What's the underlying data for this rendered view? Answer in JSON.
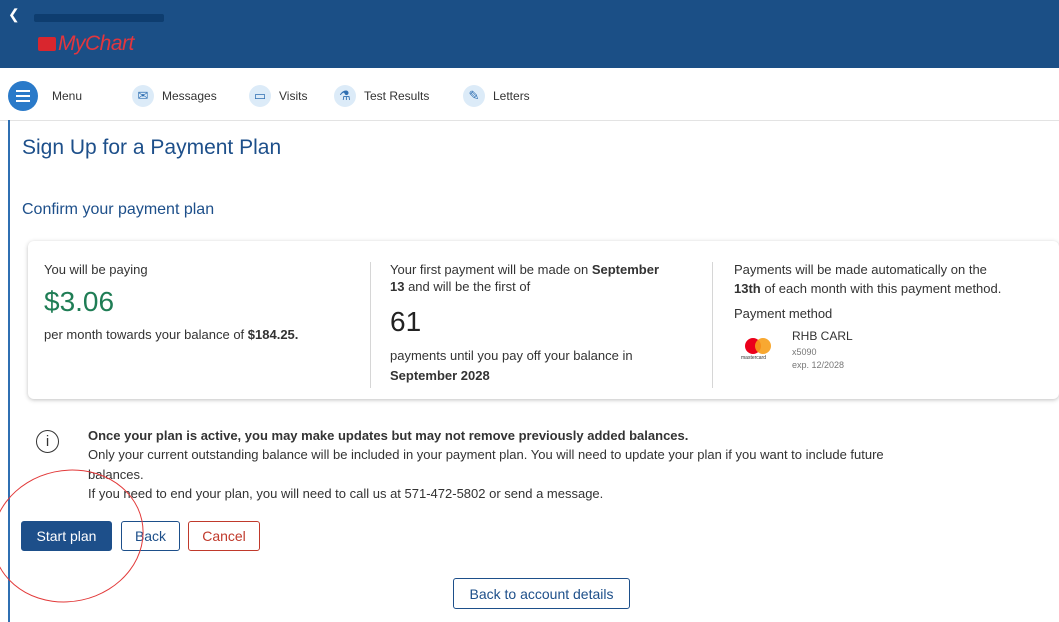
{
  "header": {
    "app_name": "MyChart"
  },
  "nav": {
    "menu_label": "Menu",
    "items": [
      {
        "label": "Messages",
        "icon": "envelope-icon"
      },
      {
        "label": "Visits",
        "icon": "calendar-icon"
      },
      {
        "label": "Test Results",
        "icon": "flask-icon"
      },
      {
        "label": "Letters",
        "icon": "letter-icon"
      }
    ]
  },
  "page": {
    "title": "Sign Up for a Payment Plan",
    "subtitle": "Confirm your payment plan"
  },
  "summary": {
    "col1": {
      "heading": "You will be paying",
      "amount": "$3.06",
      "text_before": "per month towards your balance of ",
      "balance": "$184.25."
    },
    "col2": {
      "line1_before": "Your first payment will be made on ",
      "line1_bold": "September",
      "line2_bold": "13",
      "line2_after": " and will be the first of",
      "count": "61",
      "line3": "payments until you pay off your balance in",
      "end_date": "September 2028"
    },
    "col3": {
      "line1": "Payments will be made automatically on the",
      "line2_bold": "13th",
      "line2_after": " of each month with this payment method.",
      "method_label": "Payment method",
      "card_name": "RHB CARL",
      "card_last4": "x5090",
      "card_exp": "exp. 12/2028",
      "card_brand": "mastercard"
    }
  },
  "notice": {
    "heading": "Once your plan is active, you may make updates but may not remove previously added balances.",
    "line1": "Only your current outstanding balance will be included in your payment plan. You will need to update your plan if you want to include future",
    "line2": "balances.",
    "line3": "If you need to end your plan, you will need to call us at 571-472-5802 or send a message."
  },
  "buttons": {
    "start": "Start plan",
    "back": "Back",
    "cancel": "Cancel",
    "account": "Back to account details"
  },
  "colors": {
    "header": "#1b4f86",
    "primary": "#1d4f8a",
    "amount": "#1f7d55",
    "cancel": "#c0392b",
    "annotation": "#e23a3a"
  }
}
